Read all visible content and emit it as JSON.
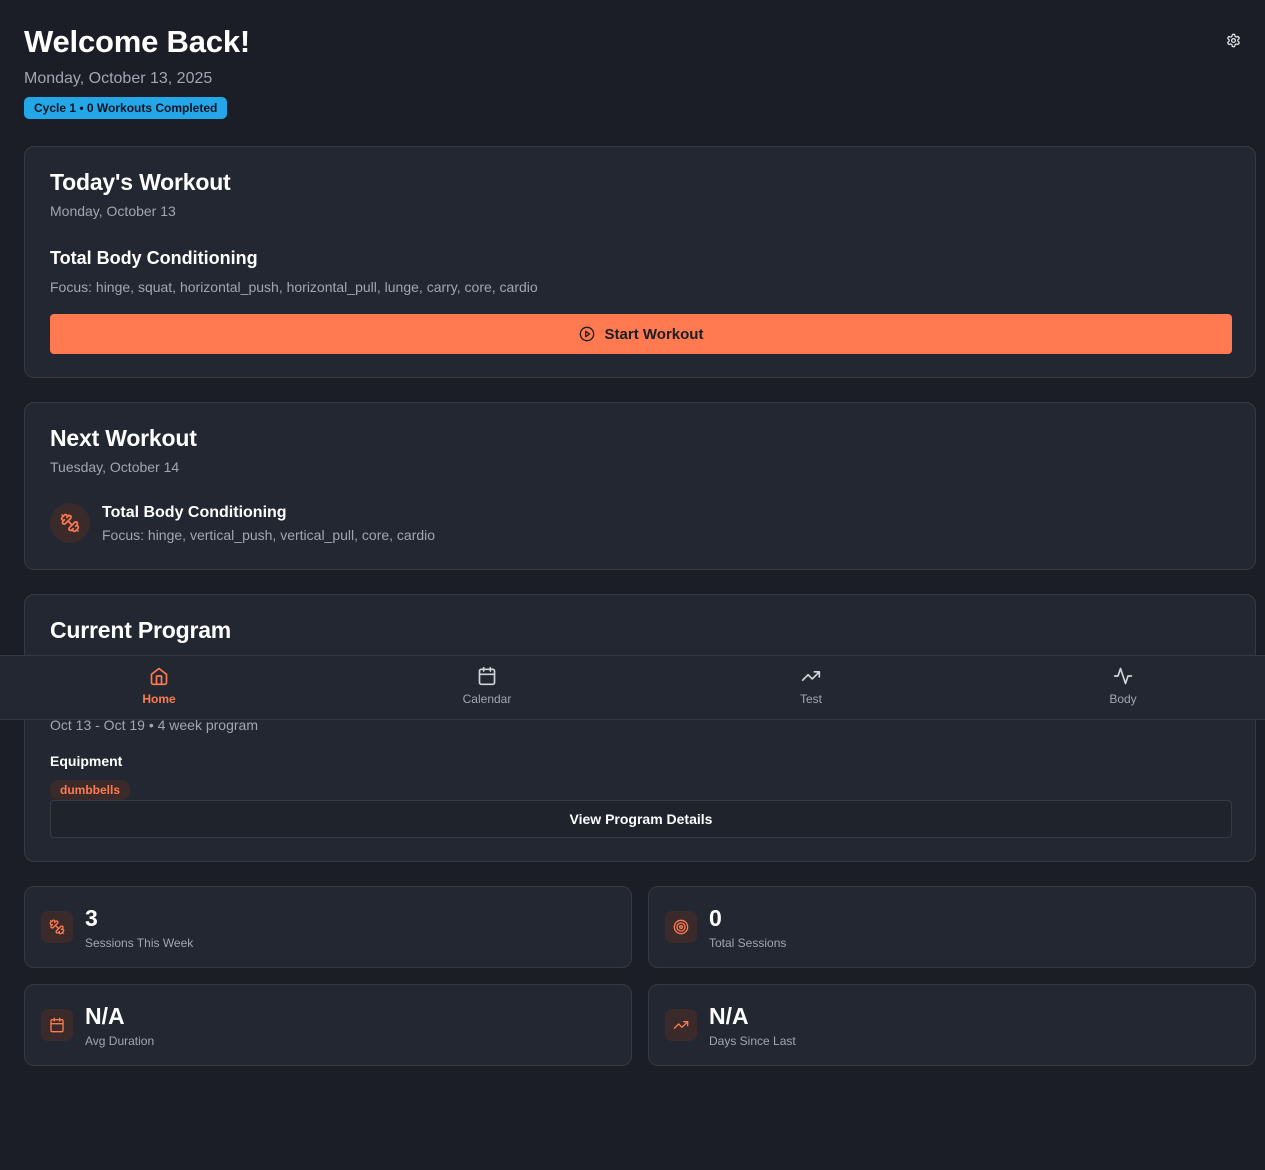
{
  "header": {
    "title": "Welcome Back!",
    "date": "Monday, October 13, 2025",
    "cycle_badge": "Cycle 1 • 0 Workouts Completed",
    "settings_icon": "gear-icon"
  },
  "today": {
    "title": "Today's Workout",
    "date": "Monday, October 13",
    "workout_name": "Total Body Conditioning",
    "focus": "Focus: hinge, squat, horizontal_push, horizontal_pull, lunge, carry, core, cardio",
    "start_label": "Start Workout",
    "start_icon": "play-circle-icon"
  },
  "next": {
    "title": "Next Workout",
    "date": "Tuesday, October 14",
    "workout_name": "Total Body Conditioning",
    "focus": "Focus: hinge, vertical_push, vertical_pull, core, cardio",
    "icon": "dumbbell-icon"
  },
  "program": {
    "title": "Current Program",
    "dates": "Oct 13 - Oct 19 • 4 week program",
    "equipment_label": "Equipment",
    "equipment": [
      "dumbbells"
    ],
    "details_label": "View Program Details"
  },
  "nav": {
    "items": [
      {
        "label": "Home",
        "icon": "home-icon",
        "active": true
      },
      {
        "label": "Calendar",
        "icon": "calendar-icon",
        "active": false
      },
      {
        "label": "Test",
        "icon": "trending-up-icon",
        "active": false
      },
      {
        "label": "Body",
        "icon": "activity-icon",
        "active": false
      }
    ]
  },
  "stats": [
    {
      "value": "3",
      "label": "Sessions This Week",
      "icon": "dumbbell-icon"
    },
    {
      "value": "0",
      "label": "Total Sessions",
      "icon": "target-icon"
    },
    {
      "value": "N/A",
      "label": "Avg Duration",
      "icon": "calendar-icon"
    },
    {
      "value": "N/A",
      "label": "Days Since Last",
      "icon": "trending-up-icon"
    }
  ],
  "colors": {
    "background": "#1b1e26",
    "card": "#232731",
    "border": "#353a46",
    "accent": "#ff7a50",
    "badge": "#23a7e8",
    "muted_text": "#a1a6b2"
  }
}
